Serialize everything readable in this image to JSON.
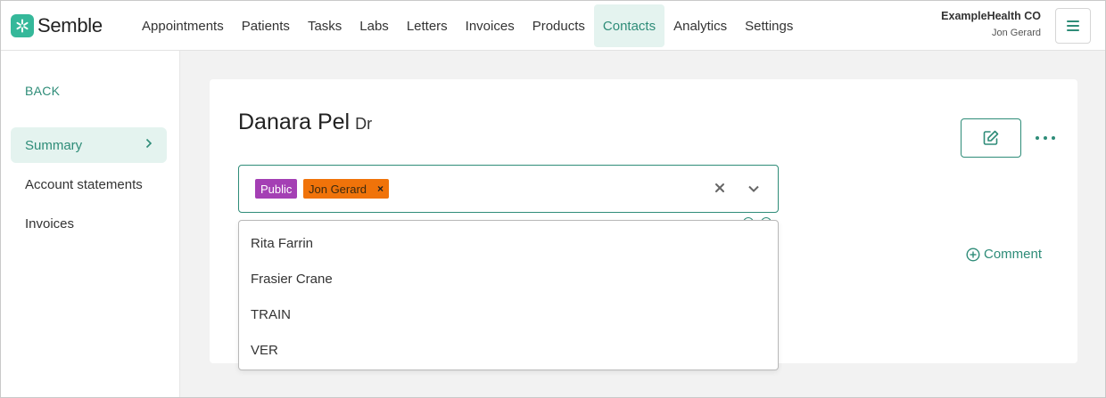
{
  "brand": {
    "name": "Semble",
    "accent": "#2e8c78",
    "logo_color": "#35b89a"
  },
  "nav": {
    "items": [
      "Appointments",
      "Patients",
      "Tasks",
      "Labs",
      "Letters",
      "Invoices",
      "Products",
      "Contacts",
      "Analytics",
      "Settings"
    ],
    "active": "Contacts"
  },
  "account": {
    "org": "ExampleHealth CO",
    "user": "Jon Gerard",
    "menu_icon": "hamburger-icon"
  },
  "sidebar": {
    "back_label": "BACK",
    "items": [
      {
        "label": "Summary",
        "active": true
      },
      {
        "label": "Account statements",
        "active": false
      },
      {
        "label": "Invoices",
        "active": false
      }
    ]
  },
  "contact": {
    "name": "Danara Pel",
    "title_suffix": "Dr"
  },
  "actions": {
    "edit_icon": "edit-icon",
    "more_icon": "more-horizontal-icon",
    "comment_label": "Comment"
  },
  "visibility_select": {
    "tags": [
      {
        "label": "Public",
        "color": "#a43fb4"
      },
      {
        "label": "Jon Gerard",
        "color": "#f0730a",
        "removable": true
      }
    ],
    "options": [
      "Rita Farrin",
      "Frasier Crane",
      "TRAIN",
      "VER"
    ]
  }
}
